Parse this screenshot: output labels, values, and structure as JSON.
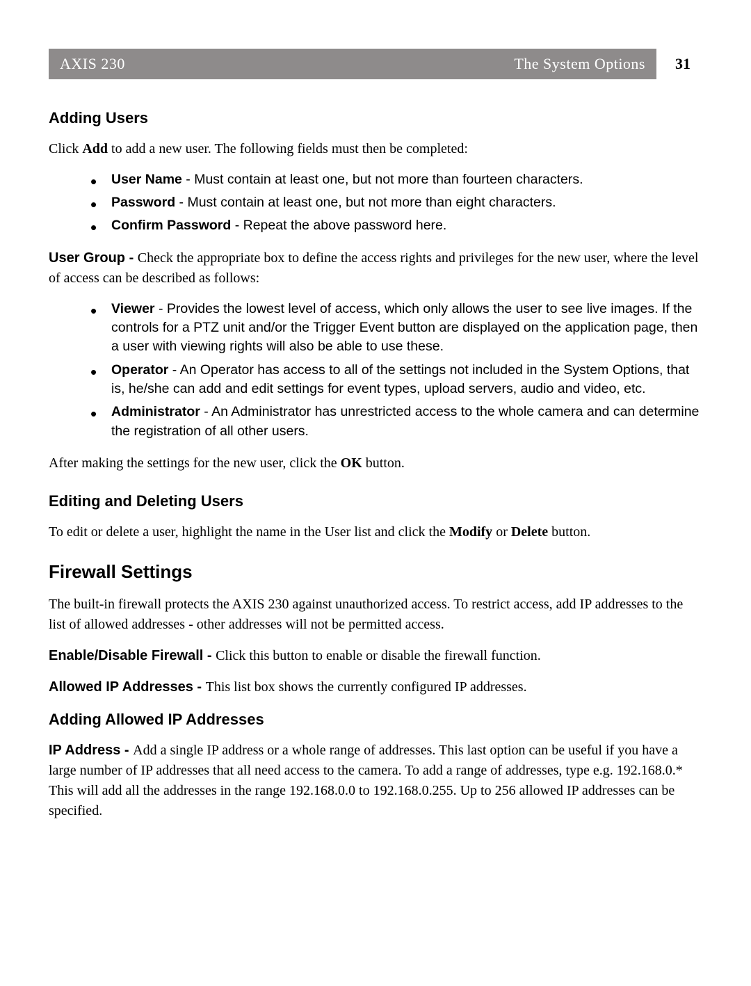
{
  "header": {
    "left": "AXIS 230",
    "right": "The System Options",
    "page_number": "31"
  },
  "sections": {
    "adding_users": {
      "title": "Adding Users",
      "intro_pre": "Click ",
      "intro_bold": "Add",
      "intro_post": " to add a new user. The following fields must then be completed:",
      "fields": [
        {
          "name": "User Name",
          "desc": " - Must contain at least one, but not more than fourteen characters."
        },
        {
          "name": "Password",
          "desc": " - Must contain at least one, but not more than eight characters."
        },
        {
          "name": "Confirm Password",
          "desc": " - Repeat the above password here."
        }
      ],
      "user_group_label": "User Group - ",
      "user_group_text": "Check the appropriate box to define the access rights and privileges for the new user, where the level of access can be described as follows:",
      "groups": [
        {
          "name": "Viewer",
          "desc": " - Provides the lowest level of access, which only allows the user to see live images. If the controls for a PTZ unit and/or the Trigger Event button are displayed on the application page, then a user with viewing rights will also be able to use these."
        },
        {
          "name": "Operator",
          "desc": " - An Operator has access to all of the settings not included in the System Options, that is, he/she can add and edit settings for event types, upload servers, audio and video, etc."
        },
        {
          "name": "Administrator",
          "desc": " - An Administrator has unrestricted access to the whole camera and can determine the registration of all other users."
        }
      ],
      "after_pre": "After making the settings for the new user, click the ",
      "after_bold": "OK",
      "after_post": " button."
    },
    "edit_delete": {
      "title": "Editing and Deleting Users",
      "text_pre": "To edit or delete a user, highlight the name in the User list and click the ",
      "text_b1": "Modify",
      "text_mid": " or ",
      "text_b2": "Delete",
      "text_post": " button."
    },
    "firewall": {
      "title": "Firewall Settings",
      "intro": "The built-in firewall protects the AXIS 230 against unauthorized access. To restrict access, add IP addresses to the list of allowed addresses - other addresses will not be permitted access.",
      "enable_label": "Enable/Disable Firewall - ",
      "enable_text": "Click this button to enable or disable the firewall function.",
      "allowed_label": "Allowed IP Addresses - ",
      "allowed_text": "This list box shows the currently configured IP addresses.",
      "adding_allowed_title": "Adding Allowed IP Addresses",
      "ip_label": "IP Address - ",
      "ip_text": "Add a single IP address or a whole range of addresses. This last option can be useful if you have a large number of IP addresses that all need access to the camera. To add a range of addresses, type e.g. 192.168.0.* This will add all the addresses in the range 192.168.0.0 to 192.168.0.255. Up to 256 allowed IP addresses can be specified."
    }
  }
}
